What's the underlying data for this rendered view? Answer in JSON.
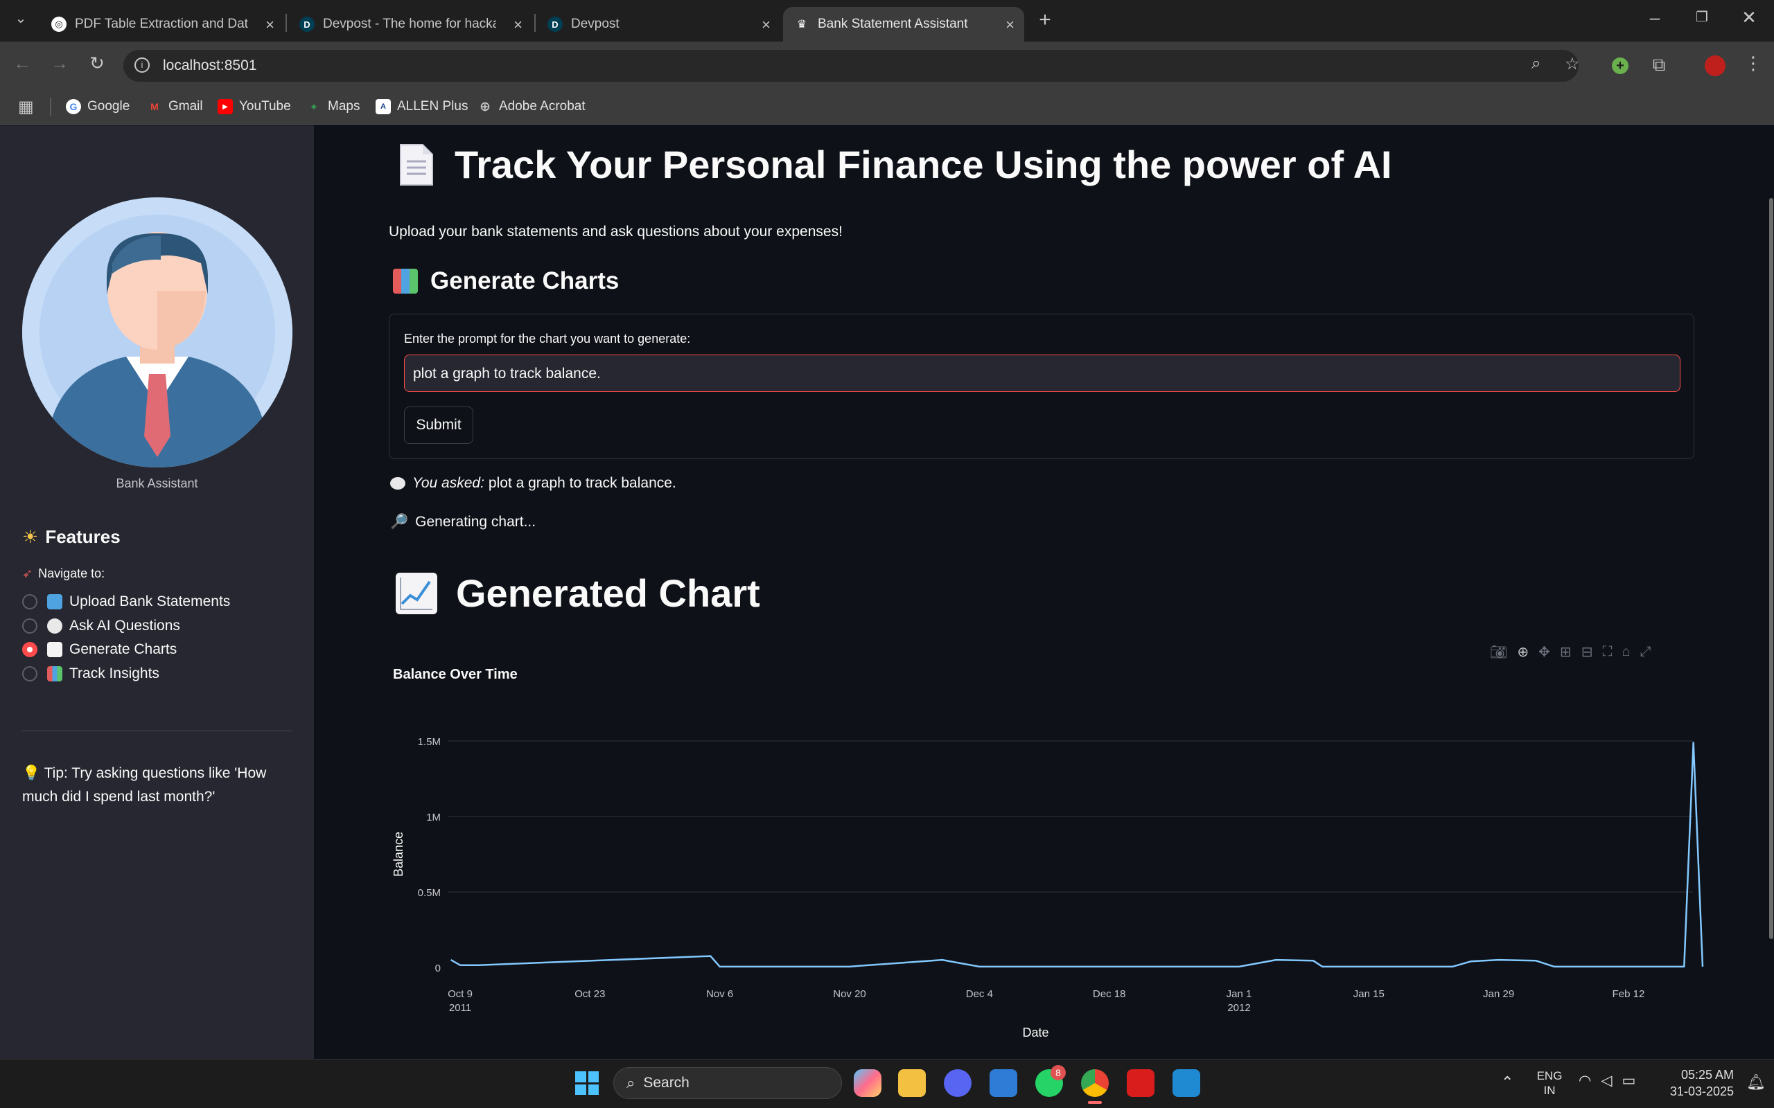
{
  "browser": {
    "tabs": [
      {
        "title": "PDF Table Extraction and Date S",
        "favicon": "openai-icon"
      },
      {
        "title": "Devpost - The home for hackath",
        "favicon": "devpost-icon"
      },
      {
        "title": "Devpost",
        "favicon": "devpost-icon"
      },
      {
        "title": "Bank Statement Assistant",
        "favicon": "streamlit-icon"
      }
    ],
    "url": "localhost:8501",
    "bookmarks": [
      "Google",
      "Gmail",
      "YouTube",
      "Maps",
      "ALLEN Plus",
      "Adobe Acrobat"
    ]
  },
  "sidebar": {
    "avatar_caption": "Bank Assistant",
    "features_heading": "Features",
    "navigate_label": "Navigate to:",
    "nav_items": [
      {
        "label": "Upload Bank Statements",
        "selected": false
      },
      {
        "label": "Ask AI Questions",
        "selected": false
      },
      {
        "label": "Generate Charts",
        "selected": true
      },
      {
        "label": "Track Insights",
        "selected": false
      }
    ],
    "tip": "Tip: Try asking questions like 'How much did I spend last month?'"
  },
  "main": {
    "title": "Track Your Personal Finance Using the power of AI",
    "subtitle": "Upload your bank statements and ask questions about your expenses!",
    "section_heading": "Generate Charts",
    "prompt_label": "Enter the prompt for the chart you want to generate:",
    "prompt_value": "plot a graph to track balance.",
    "submit_label": "Submit",
    "you_asked_prefix": "You asked:",
    "you_asked_text": "plot a graph to track balance.",
    "status": "Generating chart...",
    "chart_heading": "Generated Chart"
  },
  "chart_data": {
    "type": "line",
    "title": "Balance Over Time",
    "xlabel": "Date",
    "ylabel": "Balance",
    "ylim": [
      0,
      1500000
    ],
    "yticks": [
      "0",
      "0.5M",
      "1M",
      "1.5M"
    ],
    "xticks": [
      {
        "label": "Oct 9",
        "sub": "2011"
      },
      {
        "label": "Oct 23",
        "sub": ""
      },
      {
        "label": "Nov 6",
        "sub": ""
      },
      {
        "label": "Nov 20",
        "sub": ""
      },
      {
        "label": "Dec 4",
        "sub": ""
      },
      {
        "label": "Dec 18",
        "sub": ""
      },
      {
        "label": "Jan 1",
        "sub": "2012"
      },
      {
        "label": "Jan 15",
        "sub": ""
      },
      {
        "label": "Jan 29",
        "sub": ""
      },
      {
        "label": "Feb 12",
        "sub": ""
      }
    ],
    "series": [
      {
        "color": "#83c9ff",
        "x": [
          "2011-10-08",
          "2011-10-09",
          "2011-10-11",
          "2011-11-05",
          "2011-11-06",
          "2011-11-20",
          "2011-11-21",
          "2011-11-30",
          "2011-12-04",
          "2011-12-10",
          "2011-12-25",
          "2012-01-01",
          "2012-01-05",
          "2012-01-09",
          "2012-01-10",
          "2012-01-18",
          "2012-01-24",
          "2012-01-26",
          "2012-01-29",
          "2012-02-02",
          "2012-02-04",
          "2012-02-10",
          "2012-02-18",
          "2012-02-19",
          "2012-02-20"
        ],
        "values": [
          50000,
          15000,
          15000,
          75000,
          5000,
          5000,
          10000,
          50000,
          5000,
          5000,
          5000,
          5000,
          50000,
          45000,
          5000,
          5000,
          5000,
          40000,
          50000,
          45000,
          5000,
          5000,
          5000,
          1490000,
          5000
        ]
      }
    ],
    "colors": {
      "line": "#83c9ff",
      "grid": "#31333f"
    }
  },
  "modebar_icons": [
    "camera-icon",
    "zoom-icon",
    "pan-icon",
    "zoom-in-icon",
    "zoom-out-icon",
    "autoscale-icon",
    "reset-axes-icon",
    "fullscreen-icon"
  ],
  "taskbar": {
    "search_placeholder": "Search",
    "lang_primary": "ENG",
    "lang_secondary": "IN",
    "time": "05:25 AM",
    "date": "31-03-2025",
    "whatsapp_badge": "8"
  },
  "colors": {
    "accent": "#ff4b4b",
    "sidebar": "#262730",
    "main_bg": "#0e1117"
  }
}
